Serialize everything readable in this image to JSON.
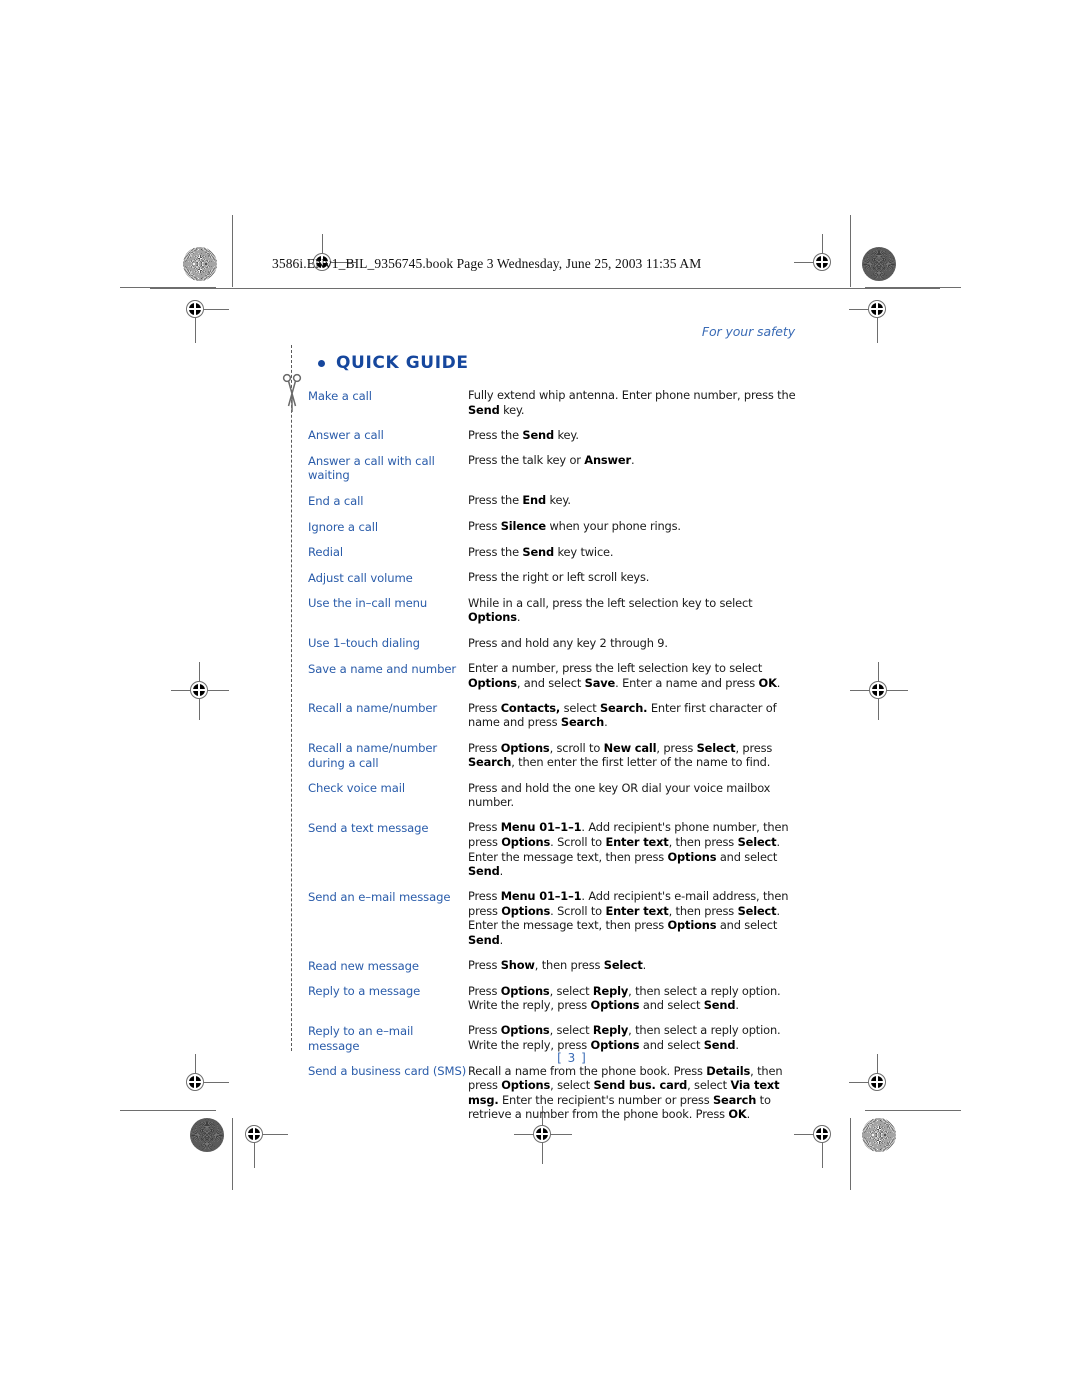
{
  "header": {
    "slug": "3586i.ENv1_BIL_9356745.book  Page 3  Wednesday, June 25, 2003  11:35 AM",
    "running_head": "For your safety"
  },
  "section": {
    "title": "QUICK GUIDE",
    "bullet_icon": "bullet-dot-icon",
    "cut_icon": "scissors-icon"
  },
  "colors": {
    "heading_blue": "#16479d",
    "term_blue": "#2a5caa",
    "running_head_blue": "#3a6bb5",
    "body_black": "#1a1a1a"
  },
  "guide": {
    "rows": [
      {
        "term": "Make a call",
        "desc": "Fully extend whip antenna. Enter phone number, press the <b>Send</b> key."
      },
      {
        "term": "Answer a call",
        "desc": "Press the <b>Send</b> key."
      },
      {
        "term": "Answer a call with call waiting",
        "desc": "Press the talk key or <b>Answer</b>."
      },
      {
        "term": "End a call",
        "desc": "Press the <b>End</b> key."
      },
      {
        "term": "Ignore a call",
        "desc": "Press <b>Silence</b> when your phone rings."
      },
      {
        "term": "Redial",
        "desc": "Press the <b>Send</b> key twice."
      },
      {
        "term": "Adjust call volume",
        "desc": "Press the right or left scroll keys."
      },
      {
        "term": "Use the in–call menu",
        "desc": "While in a call, press the left selection key to select <b>Options</b>."
      },
      {
        "term": "Use 1–touch dialing",
        "desc": "Press and hold any key 2 through 9."
      },
      {
        "term": "Save a name and number",
        "desc": "Enter a number, press the left selection key to select <b>Options</b>, and select <b>Save</b>. Enter a name and press <b>OK</b>."
      },
      {
        "term": "Recall a name/number",
        "desc": "Press <b>Contacts,</b> select <b>Search.</b> Enter first character of name and press <b>Search</b>."
      },
      {
        "term": "Recall a name/number during a call",
        "desc": "Press <b>Options</b>, scroll to <b>New call</b>, press <b>Select</b>, press <b>Search</b>, then enter the first letter of the name to find."
      },
      {
        "term": "Check voice mail",
        "desc": "Press and hold the one key OR dial your voice mailbox number."
      },
      {
        "term": "Send a text message",
        "desc": "Press <b>Menu 01–1–1</b>. Add recipient's phone number, then press <b>Options</b>. Scroll to <b>Enter text</b>, then press <b>Select</b>. Enter the message text, then press <b>Options</b> and select <b>Send</b>."
      },
      {
        "term": "Send an e–mail message",
        "desc": "Press <b>Menu 01–1–1</b>. Add recipient's e-mail address, then press <b>Options</b>. Scroll to <b>Enter text</b>, then press <b>Select</b>. Enter the message text, then press <b>Options</b> and select <b>Send</b>."
      },
      {
        "term": "Read new message",
        "desc": "Press <b>Show</b>, then press <b>Select</b>."
      },
      {
        "term": "Reply to a message",
        "desc": "Press <b>Options</b>, select <b>Reply</b>, then select a reply option. Write the reply, press <b>Options</b> and select <b>Send</b>."
      },
      {
        "term": "Reply to an e–mail message",
        "desc": "Press <b>Options</b>, select <b>Reply</b>, then select a reply option. Write the reply, press <b>Options</b> and select <b>Send</b>."
      },
      {
        "term": "Send a business card (SMS)",
        "desc": "Recall a name from the phone book. Press <b>Details</b>, then press <b>Options</b>, select <b>Send bus. card</b>, select <b>Via text msg.</b> Enter the recipient's number or press <b>Search</b> to retrieve a number from the phone book. Press <b>OK</b>."
      }
    ]
  },
  "footer": {
    "page_number": "[ 3 ]"
  }
}
